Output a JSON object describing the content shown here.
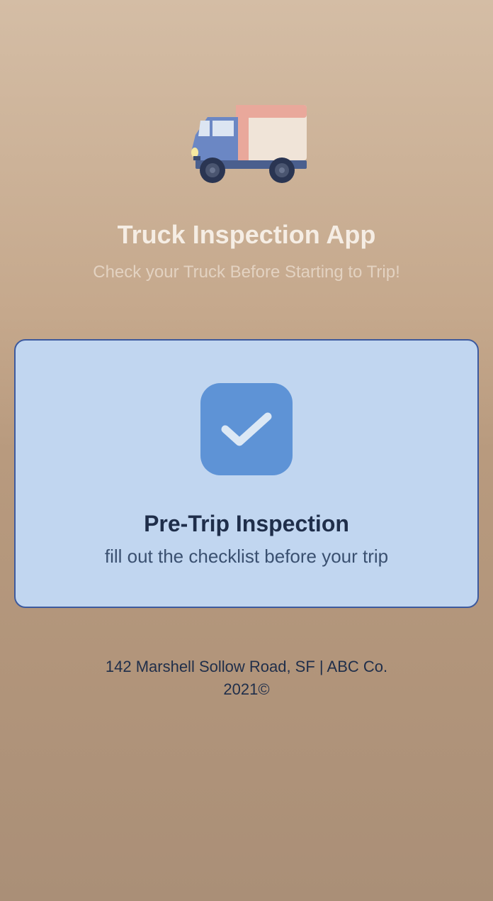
{
  "header": {
    "title": "Truck Inspection App",
    "subtitle": "Check your Truck Before Starting to Trip!"
  },
  "card": {
    "title": "Pre-Trip Inspection",
    "subtitle": "fill out the checklist before your trip"
  },
  "footer": {
    "address": "142 Marshell Sollow Road, SF | ABC Co.",
    "copyright": "2021©"
  }
}
